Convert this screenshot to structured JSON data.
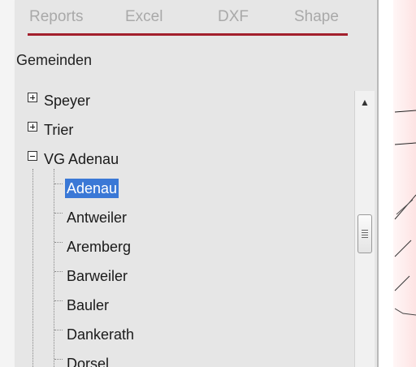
{
  "tabs": [
    "Reports",
    "Excel",
    "DXF",
    "Shape"
  ],
  "section_label": "Gemeinden",
  "tree": {
    "top_nodes": [
      {
        "label": "Speyer",
        "state": "collapsed"
      },
      {
        "label": "Trier",
        "state": "collapsed"
      },
      {
        "label": "VG Adenau",
        "state": "expanded"
      }
    ],
    "children": [
      "Adenau",
      "Antweiler",
      "Aremberg",
      "Barweiler",
      "Bauler",
      "Dankerath",
      "Dorsel"
    ],
    "selected_child": "Adenau"
  },
  "colors": {
    "tab_underline": "#a31f2c",
    "selection": "#3a78d6",
    "panel_bg": "#e6e6e6"
  },
  "icons": {
    "expander_collapsed": "plus-box-icon",
    "expander_expanded": "minus-box-icon",
    "scroll_up": "triangle-up-icon",
    "scroll_thumb": "grip-icon"
  }
}
